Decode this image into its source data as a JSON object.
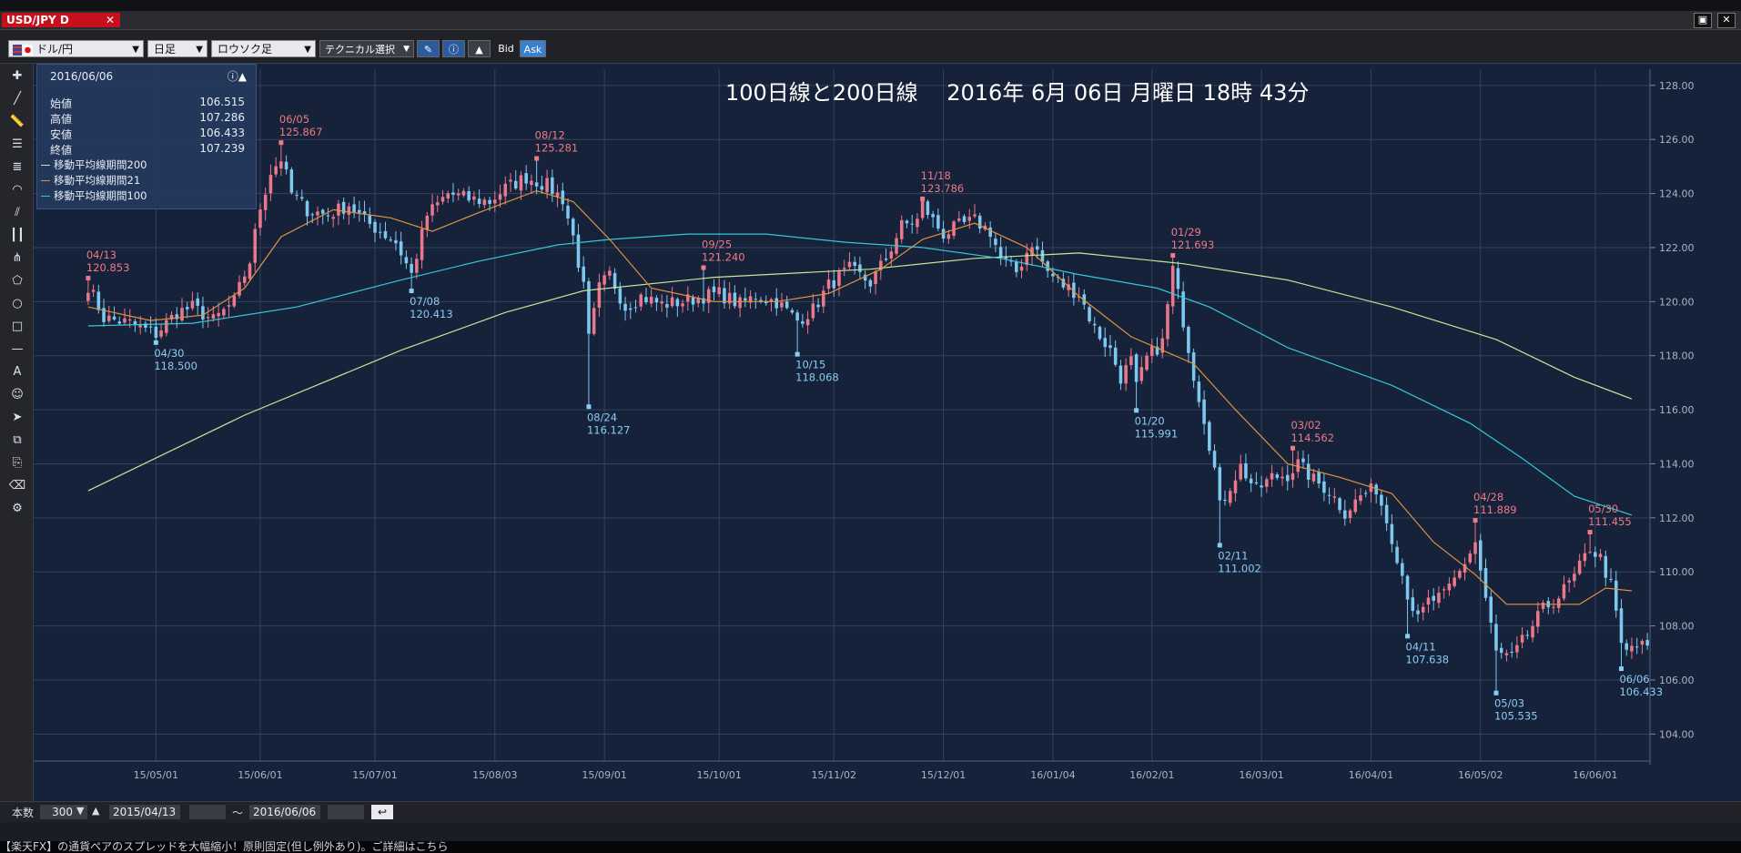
{
  "window": {
    "tab_title": "USD/JPY D",
    "tab_close": "✕",
    "max_btn": "▣",
    "close_btn": "✕"
  },
  "toolbar": {
    "currency_pair": "ドル/円",
    "timeframe": "日足",
    "chart_style": "ロウソク足",
    "technical_select": "テクニカル選択",
    "bid_label": "Bid",
    "ask_label": "Ask"
  },
  "info_panel": {
    "date": "2016/06/06",
    "open_label": "始値",
    "open_value": "106.515",
    "high_label": "高値",
    "high_value": "107.286",
    "low_label": "安値",
    "low_value": "106.433",
    "close_label": "終値",
    "close_value": "107.239",
    "ma200_label": "移動平均線期間200",
    "ma21_label": "移動平均線期間21",
    "ma100_label": "移動平均線期間100"
  },
  "bottom": {
    "count_label": "本数",
    "count_value": "300",
    "start_date": "2015/04/13",
    "tilde": "〜",
    "end_date": "2016/06/06"
  },
  "ticker_text": "【楽天FX】の通貨ペアのスプレッドを大幅縮小！原則固定(但し例外あり)。ご詳細はこちら",
  "chart_data": {
    "type": "candlestick",
    "title": "100日線と200日線　 2016年 6月 06日 月曜日 18時 43分",
    "ylim": [
      103,
      128.6
    ],
    "xlim": [
      0,
      300
    ],
    "y_ticks": [
      104,
      106,
      108,
      110,
      112,
      114,
      116,
      118,
      120,
      122,
      124,
      126,
      128
    ],
    "y_tick_labels": [
      "104.00",
      "106.00",
      "108.00",
      "110.00",
      "112.00",
      "114.00",
      "116.00",
      "118.00",
      "120.00",
      "122.00",
      "124.00",
      "126.00",
      "128.00"
    ],
    "x_ticks": [
      {
        "i": 13,
        "label": "15/05/01"
      },
      {
        "i": 33,
        "label": "15/06/01"
      },
      {
        "i": 55,
        "label": "15/07/01"
      },
      {
        "i": 78,
        "label": "15/08/03"
      },
      {
        "i": 99,
        "label": "15/09/01"
      },
      {
        "i": 121,
        "label": "15/10/01"
      },
      {
        "i": 143,
        "label": "15/11/02"
      },
      {
        "i": 164,
        "label": "15/12/01"
      },
      {
        "i": 185,
        "label": "16/01/04"
      },
      {
        "i": 204,
        "label": "16/02/01"
      },
      {
        "i": 225,
        "label": "16/03/01"
      },
      {
        "i": 246,
        "label": "16/04/01"
      },
      {
        "i": 267,
        "label": "16/05/02"
      },
      {
        "i": 289,
        "label": "16/06/01"
      }
    ],
    "colors": {
      "up": "#e8788a",
      "down": "#7cc8ee",
      "ma200": "#c7e89a",
      "ma21": "#e0923e",
      "ma100": "#33c8d8",
      "grid": "#33425e",
      "background": "#16213a",
      "high_label": "#ee7a84",
      "low_label": "#89cdf2"
    },
    "annotations": [
      {
        "i": 0,
        "date": "04/13",
        "value": "120.853",
        "type": "high"
      },
      {
        "i": 13,
        "date": "04/30",
        "value": "118.500",
        "type": "low"
      },
      {
        "i": 37,
        "date": "06/05",
        "value": "125.867",
        "type": "high"
      },
      {
        "i": 62,
        "date": "07/08",
        "value": "120.413",
        "type": "low"
      },
      {
        "i": 86,
        "date": "08/12",
        "value": "125.281",
        "type": "high"
      },
      {
        "i": 96,
        "date": "08/24",
        "value": "116.127",
        "type": "low"
      },
      {
        "i": 118,
        "date": "09/25",
        "value": "121.240",
        "type": "high"
      },
      {
        "i": 136,
        "date": "10/15",
        "value": "118.068",
        "type": "low"
      },
      {
        "i": 160,
        "date": "11/18",
        "value": "123.786",
        "type": "high"
      },
      {
        "i": 201,
        "date": "01/20",
        "value": "115.991",
        "type": "low"
      },
      {
        "i": 208,
        "date": "01/29",
        "value": "121.693",
        "type": "high"
      },
      {
        "i": 217,
        "date": "02/11",
        "value": "111.002",
        "type": "low"
      },
      {
        "i": 231,
        "date": "03/02",
        "value": "114.562",
        "type": "high"
      },
      {
        "i": 253,
        "date": "04/11",
        "value": "107.638",
        "type": "low"
      },
      {
        "i": 266,
        "date": "04/28",
        "value": "111.889",
        "type": "high"
      },
      {
        "i": 270,
        "date": "05/03",
        "value": "105.535",
        "type": "low"
      },
      {
        "i": 288,
        "date": "05/30",
        "value": "111.455",
        "type": "high"
      },
      {
        "i": 294,
        "date": "06/06",
        "value": "106.433",
        "type": "low"
      }
    ],
    "close_anchors": [
      [
        0,
        120.6
      ],
      [
        3,
        119.4
      ],
      [
        8,
        119.2
      ],
      [
        13,
        118.8
      ],
      [
        17,
        119.6
      ],
      [
        20,
        119.8
      ],
      [
        24,
        119.3
      ],
      [
        28,
        120.0
      ],
      [
        31,
        121.5
      ],
      [
        33,
        123.5
      ],
      [
        35,
        124.8
      ],
      [
        37,
        125.3
      ],
      [
        39,
        124.0
      ],
      [
        42,
        123.4
      ],
      [
        46,
        123.2
      ],
      [
        50,
        123.6
      ],
      [
        53,
        123.0
      ],
      [
        56,
        122.6
      ],
      [
        59,
        122.2
      ],
      [
        62,
        121.0
      ],
      [
        65,
        123.2
      ],
      [
        69,
        124.0
      ],
      [
        73,
        123.8
      ],
      [
        77,
        123.7
      ],
      [
        80,
        124.2
      ],
      [
        84,
        124.6
      ],
      [
        88,
        124.3
      ],
      [
        91,
        123.8
      ],
      [
        93,
        122.4
      ],
      [
        95,
        120.5
      ],
      [
        96,
        118.6
      ],
      [
        98,
        120.5
      ],
      [
        100,
        121.0
      ],
      [
        103,
        119.8
      ],
      [
        106,
        120.2
      ],
      [
        110,
        119.9
      ],
      [
        114,
        120.0
      ],
      [
        118,
        120.2
      ],
      [
        121,
        120.3
      ],
      [
        125,
        119.9
      ],
      [
        128,
        120.2
      ],
      [
        132,
        120.0
      ],
      [
        136,
        119.3
      ],
      [
        139,
        119.7
      ],
      [
        142,
        120.6
      ],
      [
        146,
        121.2
      ],
      [
        150,
        120.7
      ],
      [
        153,
        121.6
      ],
      [
        156,
        122.8
      ],
      [
        159,
        123.0
      ],
      [
        160,
        123.6
      ],
      [
        162,
        123.0
      ],
      [
        164,
        122.5
      ],
      [
        167,
        122.8
      ],
      [
        170,
        123.0
      ],
      [
        173,
        122.6
      ],
      [
        175,
        121.6
      ],
      [
        178,
        121.1
      ],
      [
        181,
        122.2
      ],
      [
        184,
        121.1
      ],
      [
        187,
        120.6
      ],
      [
        190,
        120.3
      ],
      [
        193,
        119.0
      ],
      [
        196,
        118.2
      ],
      [
        198,
        117.2
      ],
      [
        200,
        117.8
      ],
      [
        201,
        116.8
      ],
      [
        203,
        117.9
      ],
      [
        206,
        118.5
      ],
      [
        208,
        121.2
      ],
      [
        210,
        119.3
      ],
      [
        212,
        117.3
      ],
      [
        214,
        115.7
      ],
      [
        216,
        113.8
      ],
      [
        217,
        112.4
      ],
      [
        219,
        113.2
      ],
      [
        221,
        113.9
      ],
      [
        224,
        113.0
      ],
      [
        227,
        113.5
      ],
      [
        230,
        113.6
      ],
      [
        232,
        114.0
      ],
      [
        235,
        113.4
      ],
      [
        238,
        113.0
      ],
      [
        241,
        112.2
      ],
      [
        244,
        112.8
      ],
      [
        247,
        113.1
      ],
      [
        250,
        111.3
      ],
      [
        253,
        109.2
      ],
      [
        255,
        108.2
      ],
      [
        257,
        108.9
      ],
      [
        260,
        109.1
      ],
      [
        263,
        110.0
      ],
      [
        266,
        111.1
      ],
      [
        268,
        109.0
      ],
      [
        270,
        107.0
      ],
      [
        273,
        106.8
      ],
      [
        276,
        107.7
      ],
      [
        279,
        108.6
      ],
      [
        282,
        109.1
      ],
      [
        285,
        109.8
      ],
      [
        288,
        110.9
      ],
      [
        290,
        110.5
      ],
      [
        292,
        109.5
      ],
      [
        294,
        107.3
      ],
      [
        295,
        107.0
      ],
      [
        296,
        107.24
      ]
    ],
    "ma200": [
      [
        0,
        113.0
      ],
      [
        30,
        115.8
      ],
      [
        60,
        118.2
      ],
      [
        80,
        119.6
      ],
      [
        95,
        120.4
      ],
      [
        120,
        120.9
      ],
      [
        150,
        121.2
      ],
      [
        170,
        121.6
      ],
      [
        190,
        121.8
      ],
      [
        210,
        121.4
      ],
      [
        230,
        120.8
      ],
      [
        250,
        119.8
      ],
      [
        270,
        118.6
      ],
      [
        285,
        117.2
      ],
      [
        296,
        116.4
      ]
    ],
    "ma21": [
      [
        0,
        119.8
      ],
      [
        12,
        119.3
      ],
      [
        22,
        119.5
      ],
      [
        30,
        120.5
      ],
      [
        37,
        122.4
      ],
      [
        47,
        123.4
      ],
      [
        58,
        123.1
      ],
      [
        66,
        122.6
      ],
      [
        75,
        123.3
      ],
      [
        86,
        124.1
      ],
      [
        93,
        123.7
      ],
      [
        100,
        122.3
      ],
      [
        108,
        120.5
      ],
      [
        120,
        120.0
      ],
      [
        132,
        120.0
      ],
      [
        142,
        120.3
      ],
      [
        152,
        121.2
      ],
      [
        160,
        122.3
      ],
      [
        170,
        122.9
      ],
      [
        180,
        122.0
      ],
      [
        190,
        120.2
      ],
      [
        200,
        118.7
      ],
      [
        206,
        118.2
      ],
      [
        212,
        117.7
      ],
      [
        220,
        116.0
      ],
      [
        230,
        114.0
      ],
      [
        240,
        113.5
      ],
      [
        250,
        112.9
      ],
      [
        258,
        111.1
      ],
      [
        266,
        109.9
      ],
      [
        272,
        108.8
      ],
      [
        280,
        108.8
      ],
      [
        286,
        108.8
      ],
      [
        291,
        109.4
      ],
      [
        296,
        109.3
      ]
    ],
    "ma100": [
      [
        0,
        119.1
      ],
      [
        20,
        119.2
      ],
      [
        40,
        119.8
      ],
      [
        60,
        120.8
      ],
      [
        75,
        121.5
      ],
      [
        90,
        122.1
      ],
      [
        100,
        122.3
      ],
      [
        115,
        122.5
      ],
      [
        130,
        122.5
      ],
      [
        145,
        122.2
      ],
      [
        160,
        122.0
      ],
      [
        175,
        121.6
      ],
      [
        190,
        121.0
      ],
      [
        205,
        120.5
      ],
      [
        215,
        119.8
      ],
      [
        230,
        118.3
      ],
      [
        250,
        116.9
      ],
      [
        265,
        115.5
      ],
      [
        275,
        114.2
      ],
      [
        285,
        112.8
      ],
      [
        296,
        112.1
      ]
    ]
  }
}
